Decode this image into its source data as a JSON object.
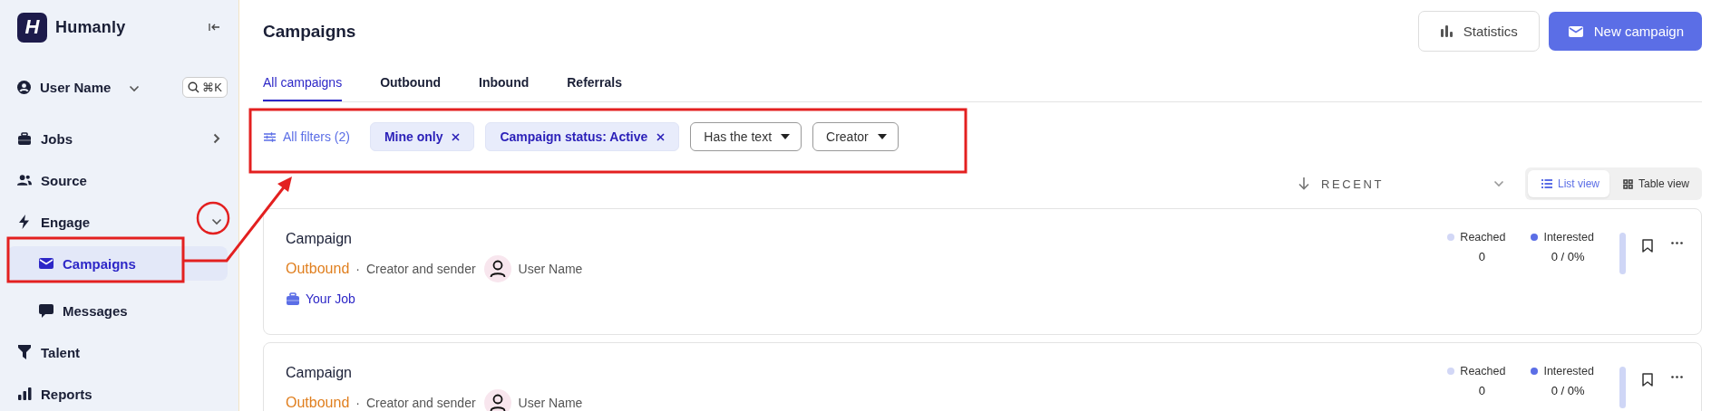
{
  "sidebar": {
    "logo_mark": "H",
    "brand": "Humanly",
    "user": {
      "name": "User Name",
      "shortcut": "⌘K"
    },
    "items": [
      {
        "label": "Jobs",
        "selected": false,
        "expanded": false
      },
      {
        "label": "Source",
        "selected": false
      },
      {
        "label": "Engage",
        "selected": false,
        "expanded": true,
        "children": [
          {
            "label": "Campaigns",
            "selected": true
          },
          {
            "label": "Messages",
            "selected": false
          }
        ]
      },
      {
        "label": "Talent",
        "selected": false
      },
      {
        "label": "Reports",
        "selected": false
      }
    ]
  },
  "header": {
    "title": "Campaigns",
    "actions": [
      {
        "label": "Statistics",
        "kind": "secondary"
      },
      {
        "label": "New campaign",
        "kind": "primary"
      }
    ]
  },
  "tabs": [
    {
      "label": "All campaigns",
      "selected": true
    },
    {
      "label": "Outbound",
      "selected": false
    },
    {
      "label": "Inbound",
      "selected": false
    },
    {
      "label": "Referrals",
      "selected": false
    }
  ],
  "filters": {
    "all_filters": "All filters (2)",
    "chips": [
      {
        "label": "Mine only",
        "kind": "applied"
      },
      {
        "label": "Campaign status: Active",
        "kind": "applied"
      },
      {
        "label": "Has the text",
        "kind": "dropdown"
      },
      {
        "label": "Creator",
        "kind": "dropdown"
      }
    ]
  },
  "sort": {
    "label": "RECENT"
  },
  "views": [
    {
      "label": "List view",
      "selected": true
    },
    {
      "label": "Table view",
      "selected": false
    }
  ],
  "campaigns": [
    {
      "name": "Campaign",
      "type": "Outbound",
      "separator": "·",
      "role": "Creator and sender",
      "user": "User Name",
      "job": "Your Job",
      "stats": [
        {
          "label": "Reached",
          "value": "0",
          "color": "#d2d7f6"
        },
        {
          "label": "Interested",
          "value": "0 / 0%",
          "color": "#5b6ee6"
        }
      ]
    },
    {
      "name": "Campaign",
      "type": "Outbound",
      "separator": "·",
      "role": "Creator and sender",
      "user": "User Name",
      "stats": [
        {
          "label": "Reached",
          "value": "0",
          "color": "#d2d7f6"
        },
        {
          "label": "Interested",
          "value": "0 / 0%",
          "color": "#5b6ee6"
        }
      ]
    }
  ]
}
